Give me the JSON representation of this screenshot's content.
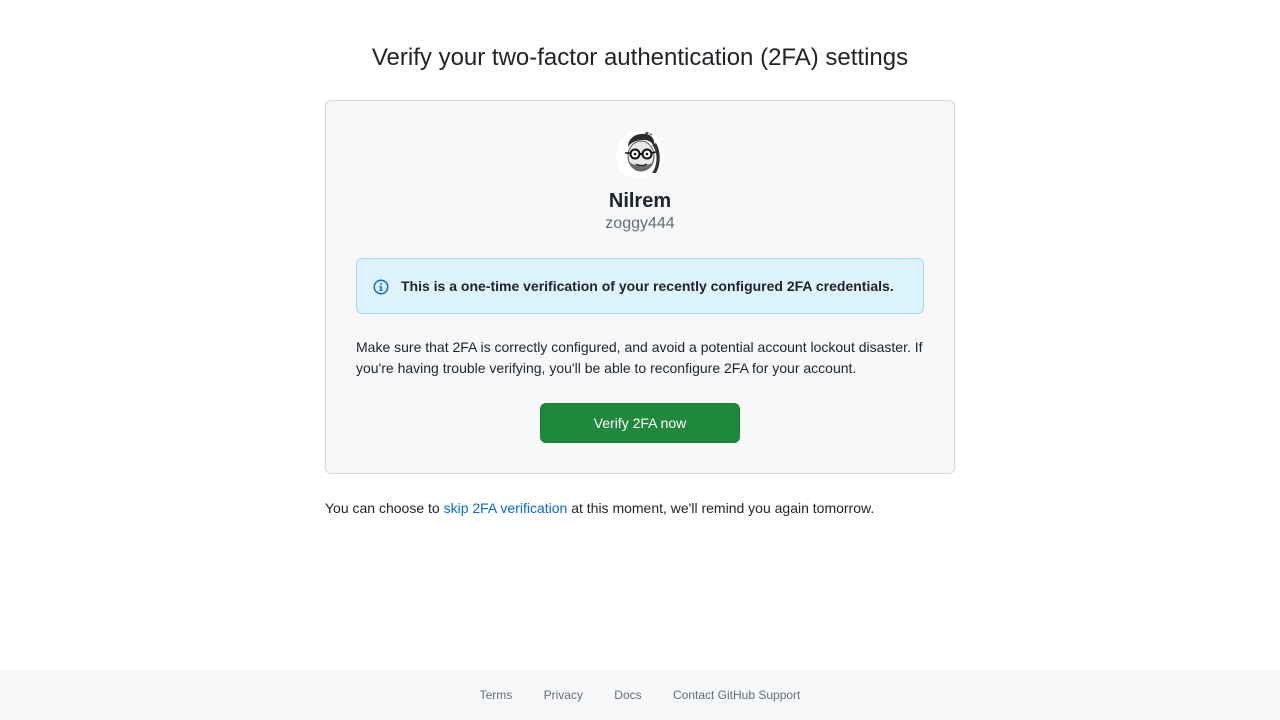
{
  "page": {
    "title": "Verify your two-factor authentication (2FA) settings"
  },
  "user": {
    "name": "Nilrem",
    "login": "zoggy444",
    "avatar_icon": "avatar-portrait-icon"
  },
  "flash": {
    "icon": "info-icon",
    "color": "#0969da",
    "background": "#ddf4ff",
    "message": "This is a one-time verification of your recently configured 2FA credentials."
  },
  "description": "Make sure that 2FA is correctly configured, and avoid a potential account lockout disaster. If you're having trouble verifying, you'll be able to reconfigure 2FA for your account.",
  "verify_button": {
    "label": "Verify 2FA now",
    "color": "#1f883d"
  },
  "skip": {
    "prefix": "You can choose to ",
    "link_label": "skip 2FA verification",
    "suffix": " at this moment, we'll remind you again tomorrow."
  },
  "footer": {
    "links": [
      "Terms",
      "Privacy",
      "Docs",
      "Contact GitHub Support"
    ]
  }
}
